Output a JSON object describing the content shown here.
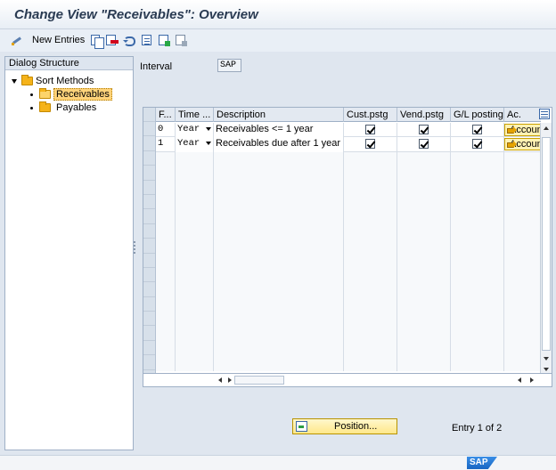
{
  "window": {
    "title": "Change View \"Receivables\": Overview"
  },
  "toolbar": {
    "new_entries_label": "New Entries"
  },
  "dialog_structure": {
    "header": "Dialog Structure",
    "root": "Sort Methods",
    "items": [
      {
        "label": "Receivables",
        "selected": true
      },
      {
        "label": "Payables",
        "selected": false
      }
    ]
  },
  "interval": {
    "label": "Interval",
    "value": "SAP"
  },
  "table": {
    "columns": [
      "F...",
      "Time ...",
      "Description",
      "Cust.pstg",
      "Vend.pstg",
      "G/L posting",
      "Ac."
    ],
    "rows": [
      {
        "f": "0",
        "time": "Year",
        "description": "Receivables <= 1 year",
        "cust": true,
        "vend": true,
        "gl": true,
        "account": "Account"
      },
      {
        "f": "1",
        "time": "Year",
        "description": "Receivables due after 1 year",
        "cust": true,
        "vend": true,
        "gl": true,
        "account": "Account"
      }
    ]
  },
  "footer": {
    "position_label": "Position...",
    "entry_info": "Entry 1 of 2"
  },
  "status": {
    "logo_text": "SAP"
  }
}
